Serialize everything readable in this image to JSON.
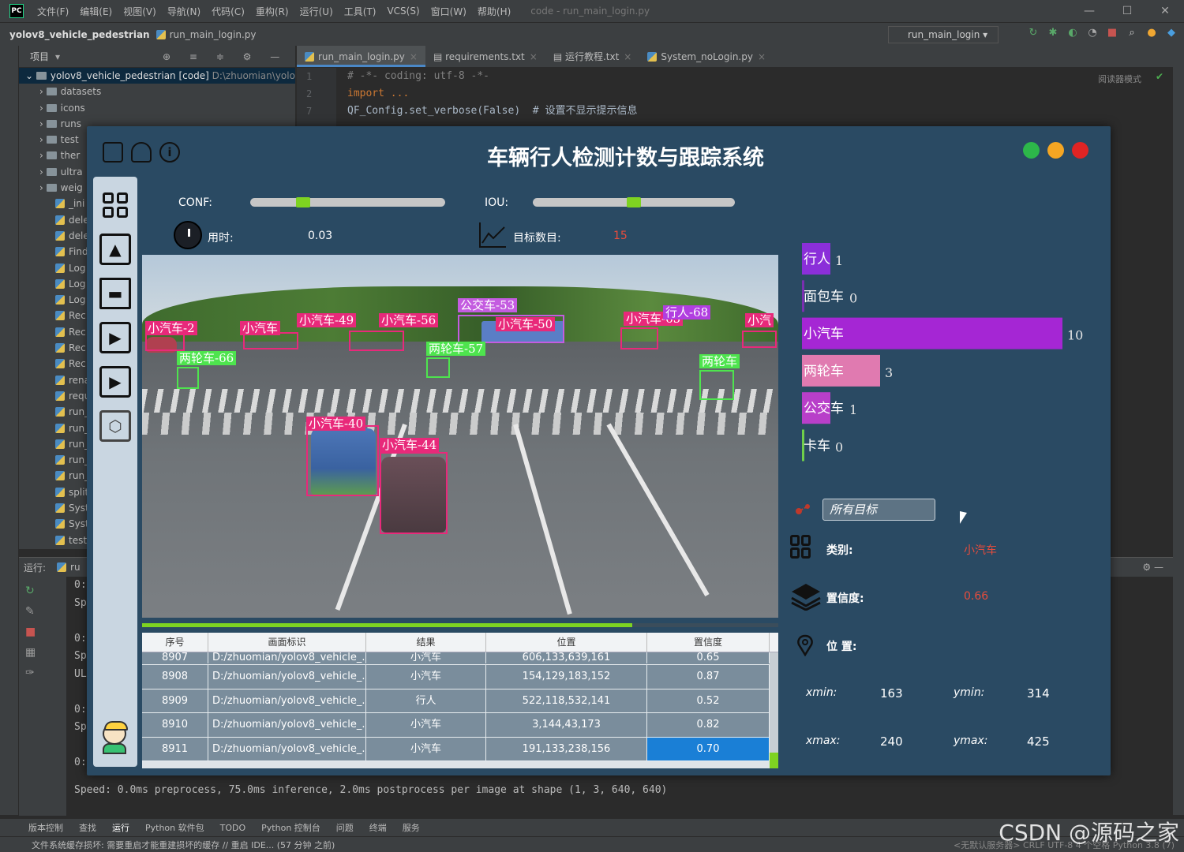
{
  "ide": {
    "menu": [
      "文件(F)",
      "编辑(E)",
      "视图(V)",
      "导航(N)",
      "代码(C)",
      "重构(R)",
      "运行(U)",
      "工具(T)",
      "VCS(S)",
      "窗口(W)",
      "帮助(H)"
    ],
    "window_title": "code - run_main_login.py",
    "breadcrumb_project": "yolov8_vehicle_pedestrian",
    "breadcrumb_file": "run_main_login.py",
    "run_config": "run_main_login",
    "project_label": "项目",
    "tree_root_name": "yolov8_vehicle_pedestrian [code]",
    "tree_root_path": "D:\\zhuomian\\yolo",
    "tree_dirs": [
      "datasets",
      "icons",
      "runs",
      "test",
      "ther",
      "ultra",
      "weig"
    ],
    "tree_files": [
      "_ini",
      "dele",
      "dele",
      "Find",
      "Log",
      "Log",
      "Log",
      "Rec",
      "Rec",
      "Rec",
      "Rec",
      "rena",
      "requ",
      "run_",
      "run_",
      "run_",
      "run_",
      "run_",
      "split",
      "Syst",
      "Syst",
      "test"
    ],
    "tabs": [
      "run_main_login.py",
      "requirements.txt",
      "运行教程.txt",
      "System_noLogin.py"
    ],
    "line_numbers": [
      "1",
      "2",
      "7"
    ],
    "code_lines": [
      {
        "kind": "comment",
        "text": "# -*- coding: utf-8 -*-"
      },
      {
        "kind": "keyword",
        "text": "import ..."
      },
      {
        "kind": "plain",
        "text": "QF_Config.set_verbose(False)  # 设置不显示提示信息"
      }
    ],
    "reader_mode": "阅读器模式",
    "run_label": "运行:",
    "run_tab": "ru",
    "console_lines": [
      "0:",
      "Sp",
      "",
      "0:",
      "Sp",
      "UL",
      "",
      "0:",
      "Sp",
      "",
      "0:"
    ],
    "console_speed": "Speed: 0.0ms preprocess, 75.0ms inference, 2.0ms postprocess per image at shape (1, 3, 640, 640)",
    "bottom_tools": [
      "版本控制",
      "查找",
      "运行",
      "Python 软件包",
      "TODO",
      "Python 控制台",
      "问题",
      "终端",
      "服务"
    ],
    "status_message": "文件系统缓存损坏: 需要重启才能重建损坏的缓存 // 重启 IDE... (57 分钟 之前)",
    "status_right": "<无默认服务器>   CRLF   UTF-8   4 个空格   Python 3.8 (7)",
    "watermark": "CSDN @源码之家"
  },
  "app": {
    "title": "车辆行人检测计数与跟踪系统",
    "conf_label": "CONF:",
    "iou_label": "IOU:",
    "conf_value": 0.27,
    "iou_value": 0.5,
    "time_label": "用时:",
    "time_value": "0.03",
    "count_label": "目标数目:",
    "count_value": "15",
    "progress": 0.77,
    "colors": {
      "close": "#e02424",
      "minimize": "#f5a623",
      "maximize": "#2db74a",
      "accent": "#7ed321"
    },
    "detections": [
      {
        "label": "小汽车-2",
        "color": "#e8297a"
      },
      {
        "label": "小汽车",
        "color": "#e8297a"
      },
      {
        "label": "小汽车-49",
        "color": "#e8297a"
      },
      {
        "label": "小汽车-56",
        "color": "#e8297a"
      },
      {
        "label": "公交车-53",
        "color": "#c45ce0"
      },
      {
        "label": "小汽车-50",
        "color": "#e8297a"
      },
      {
        "label": "小汽车-65",
        "color": "#e8297a"
      },
      {
        "label": "行人-68",
        "color": "#b13ee0"
      },
      {
        "label": "小汽",
        "color": "#e8297a"
      },
      {
        "label": "两轮车-66",
        "color": "#4ee44e"
      },
      {
        "label": "两轮车-57",
        "color": "#4ee44e"
      },
      {
        "label": "两轮车",
        "color": "#4ee44e"
      },
      {
        "label": "小汽车-40",
        "color": "#e8297a"
      },
      {
        "label": "小汽车-44",
        "color": "#e8297a"
      }
    ],
    "table": {
      "headers": [
        "序号",
        "画面标识",
        "结果",
        "位置",
        "置信度"
      ],
      "rows": [
        {
          "id": "8907",
          "file": "D:/zhuomian/yolov8_vehicle_...",
          "result": "小汽车",
          "pos": "606,133,639,161",
          "conf": "0.65"
        },
        {
          "id": "8908",
          "file": "D:/zhuomian/yolov8_vehicle_...",
          "result": "小汽车",
          "pos": "154,129,183,152",
          "conf": "0.87"
        },
        {
          "id": "8909",
          "file": "D:/zhuomian/yolov8_vehicle_...",
          "result": "行人",
          "pos": "522,118,532,141",
          "conf": "0.52"
        },
        {
          "id": "8910",
          "file": "D:/zhuomian/yolov8_vehicle_...",
          "result": "小汽车",
          "pos": "3,144,43,173",
          "conf": "0.82"
        },
        {
          "id": "8911",
          "file": "D:/zhuomian/yolov8_vehicle_...",
          "result": "小汽车",
          "pos": "191,133,238,156",
          "conf": "0.70"
        }
      ]
    },
    "combo_value": "所有目标",
    "category_label": "类别:",
    "category_value": "小汽车",
    "confidence_label": "置信度:",
    "confidence_value": "0.66",
    "position_label": "位 置:",
    "xmin_label": "xmin:",
    "xmin_value": "163",
    "ymin_label": "ymin:",
    "ymin_value": "314",
    "xmax_label": "xmax:",
    "xmax_value": "240",
    "ymax_label": "ymax:",
    "ymax_value": "425"
  },
  "chart_data": {
    "type": "bar",
    "orientation": "horizontal",
    "categories": [
      "行人",
      "面包车",
      "小汽车",
      "两轮车",
      "公交车",
      "卡车"
    ],
    "values": [
      1,
      0,
      10,
      3,
      1,
      0
    ],
    "colors": [
      "#8b2fd9",
      "#7a2fb0",
      "#a526d4",
      "#e07ab0",
      "#b83fc9",
      "#6fcf4a"
    ],
    "xlim": [
      0,
      10
    ]
  }
}
